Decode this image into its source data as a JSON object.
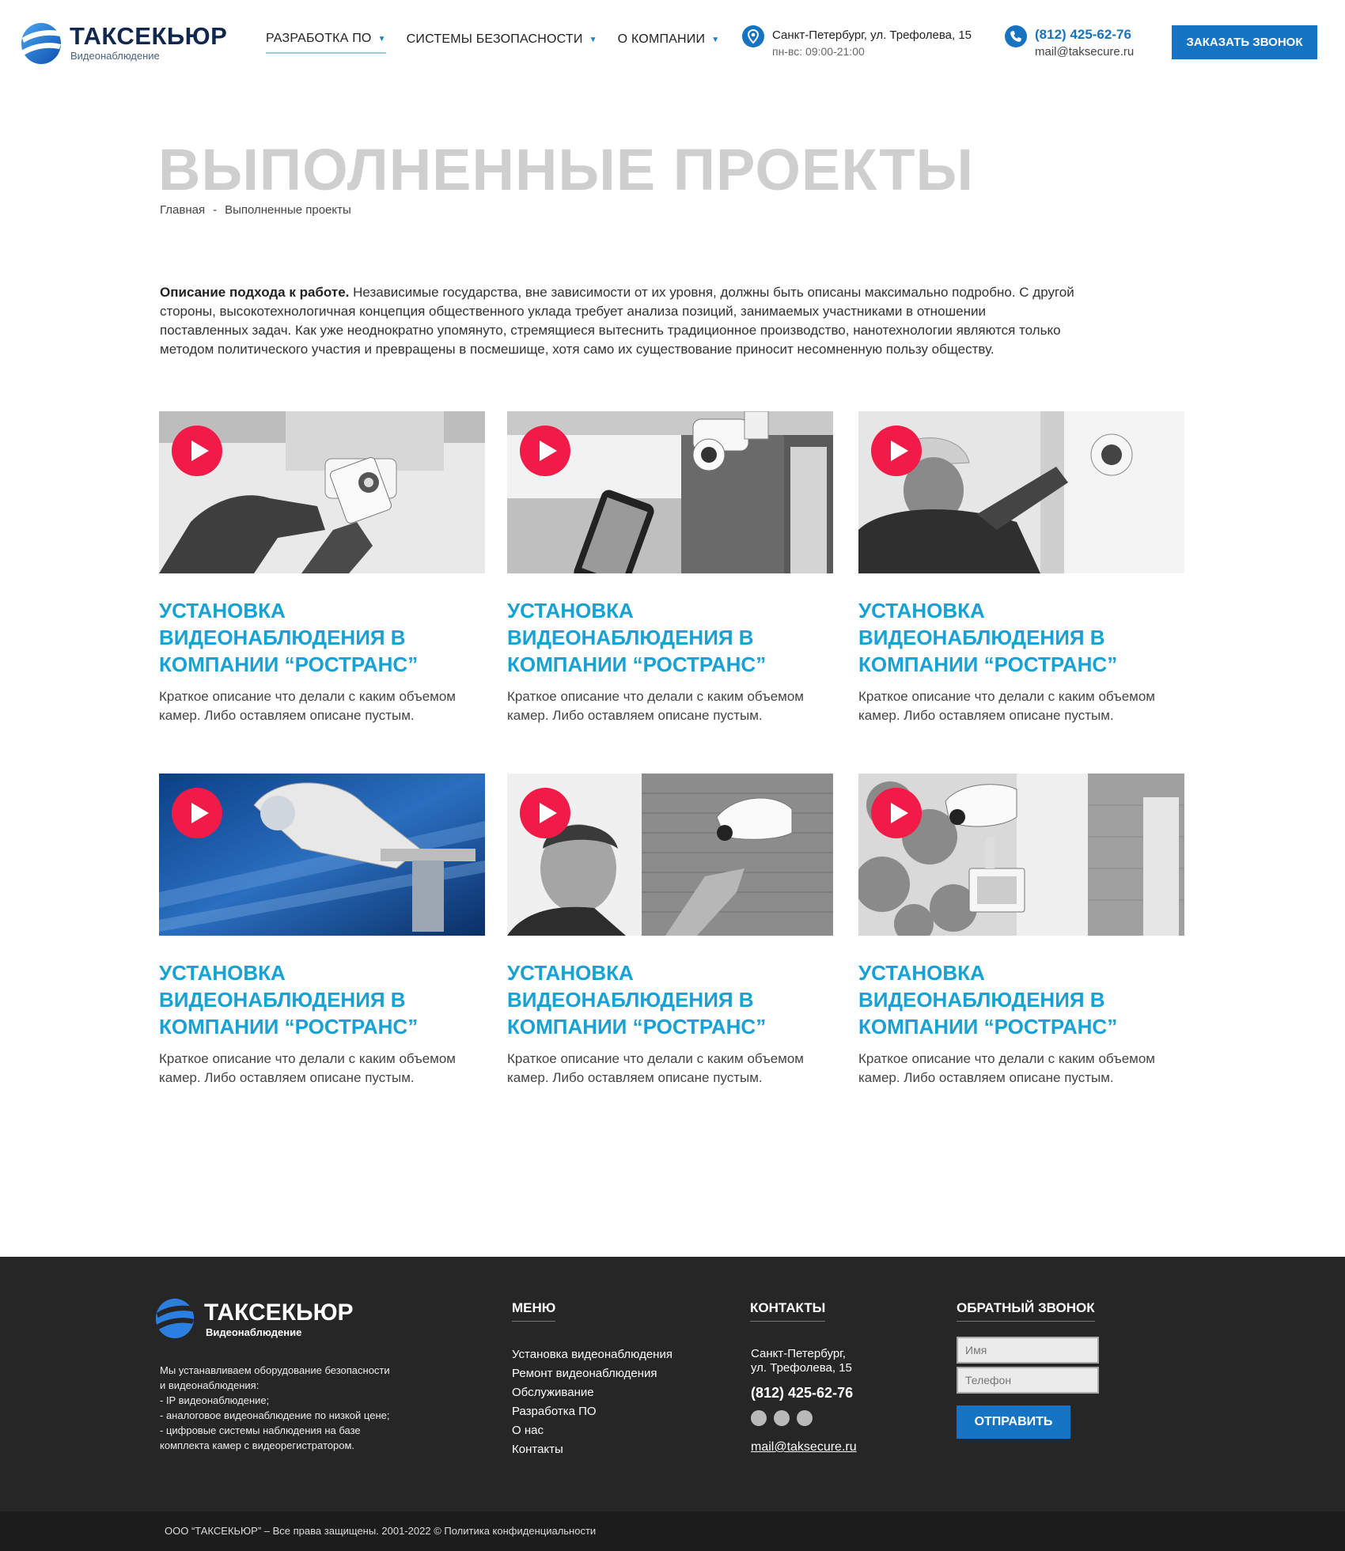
{
  "header": {
    "logo_title": "ТАКСЕКЬЮР",
    "logo_sub": "Видеонаблюдение",
    "nav": [
      {
        "label": "РАЗРАБОТКА ПО",
        "active": true
      },
      {
        "label": "СИСТЕМЫ БЕЗОПАСНОСТИ",
        "active": false
      },
      {
        "label": "О КОМПАНИИ",
        "active": false
      }
    ],
    "address": "Санкт-Петербург, ул. Трефолева, 15",
    "hours": "пн-вс: 09:00-21:00",
    "phone": "(812) 425-62-76",
    "email": "mail@taksecure.ru",
    "cta_label": "ЗАКАЗАТЬ ЗВОНОК",
    "icons": [
      "location-pin-icon",
      "phone-icon",
      "dropdown-arrow-icon"
    ]
  },
  "page": {
    "title": "ВЫПОЛНЕННЫЕ ПРОЕКТЫ",
    "breadcrumb": [
      "Главная",
      "-",
      "Выполненные проекты"
    ],
    "intro_bold": "Описание подхода к работе.",
    "intro_text": " Независимые государства, вне зависимости от их уровня, должны быть описаны максимально подробно. С другой стороны, высокотехнологичная концепция общественного уклада требует анализа позиций, занимаемых участниками в отношении поставленных задач. Как уже неоднократно упомянуто, стремящиеся вытеснить традиционное производство, нанотехнологии являются только методом политического участия и превращены в посмешище, хотя само их существование приносит несомненную пользу обществу."
  },
  "projects": [
    {
      "title": "УСТАНОВКА ВИДЕОНАБЛЮДЕНИЯ В КОМПАНИИ “РОСТРАНС”",
      "desc": "Краткое описание что делали с каким объемом камер. Либо оставляем описане пустым."
    },
    {
      "title": "УСТАНОВКА ВИДЕОНАБЛЮДЕНИЯ В КОМПАНИИ “РОСТРАНС”",
      "desc": "Краткое описание что делали с каким объемом камер. Либо оставляем описане пустым."
    },
    {
      "title": "УСТАНОВКА ВИДЕОНАБЛЮДЕНИЯ В КОМПАНИИ “РОСТРАНС”",
      "desc": "Краткое описание что делали с каким объемом камер. Либо оставляем описане пустым."
    },
    {
      "title": "УСТАНОВКА ВИДЕОНАБЛЮДЕНИЯ В КОМПАНИИ “РОСТРАНС”",
      "desc": "Краткое описание что делали с каким объемом камер. Либо оставляем описане пустым."
    },
    {
      "title": "УСТАНОВКА ВИДЕОНАБЛЮДЕНИЯ В КОМПАНИИ “РОСТРАНС”",
      "desc": "Краткое описание что делали с каким объемом камер. Либо оставляем описане пустым."
    },
    {
      "title": "УСТАНОВКА ВИДЕОНАБЛЮДЕНИЯ В КОМПАНИИ “РОСТРАНС”",
      "desc": "Краткое описание что делали с каким объемом камер. Либо оставляем описане пустым."
    }
  ],
  "footer": {
    "logo_title": "ТАКСЕКЬЮР",
    "logo_sub": "Видеонаблюдение",
    "about_lines": [
      "Мы устанавливаем оборудование безопасности",
      "и видеонаблюдения:",
      "- IP видеонаблюдение;",
      "- аналоговое видеонаблюдение по низкой цене;",
      "- цифровые системы наблюдения на базе",
      "комплекта камер с видеорегистратором."
    ],
    "menu_head": "МЕНЮ",
    "menu": [
      "Установка видеонаблюдения",
      "Ремонт видеонаблюдения",
      "Обслуживание",
      "Разработка ПО",
      "О нас",
      "Контакты"
    ],
    "contacts_head": "КОНТАКТЫ",
    "addr_line1": "Санкт-Петербург,",
    "addr_line2": "ул. Трефолева, 15",
    "phone": "(812) 425-62-76",
    "socials": [
      "whatsapp-icon",
      "telegram-icon",
      "viber-icon"
    ],
    "email": "mail@taksecure.ru",
    "callback_head": "ОБРАТНЫЙ ЗВОНОК",
    "name_placeholder": "Имя",
    "phone_placeholder": "Телефон",
    "submit_label": "ОТПРАВИТЬ",
    "copyright": "ООО “ТАКСЕКЬЮР” – Все права защищены.  2001-2022 © Политика конфиденциальности"
  },
  "colors": {
    "accent": "#1575c4",
    "title_blue": "#17a1d4",
    "play_red": "#f21a46",
    "footer_bg": "#262626"
  }
}
